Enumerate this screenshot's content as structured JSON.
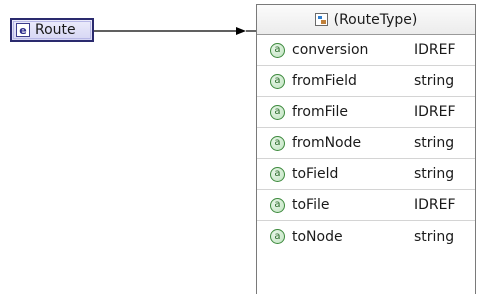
{
  "element": {
    "icon_letter": "e",
    "name": "Route"
  },
  "complex_type": {
    "title": "(RouteType)",
    "attributes": [
      {
        "icon_letter": "a",
        "name": "conversion",
        "type": "IDREF"
      },
      {
        "icon_letter": "a",
        "name": "fromField",
        "type": "string"
      },
      {
        "icon_letter": "a",
        "name": "fromFile",
        "type": "IDREF"
      },
      {
        "icon_letter": "a",
        "name": "fromNode",
        "type": "string"
      },
      {
        "icon_letter": "a",
        "name": "toField",
        "type": "string"
      },
      {
        "icon_letter": "a",
        "name": "toFile",
        "type": "IDREF"
      },
      {
        "icon_letter": "a",
        "name": "toNode",
        "type": "string"
      }
    ]
  },
  "colors": {
    "element_border": "#2a2a6e",
    "element_fill": "#d6d6f4",
    "attribute_icon": "#3e8a3e",
    "connector": "#000000"
  },
  "icons": {
    "element": "element-icon",
    "type": "complex-type-icon",
    "attribute": "attribute-icon"
  }
}
